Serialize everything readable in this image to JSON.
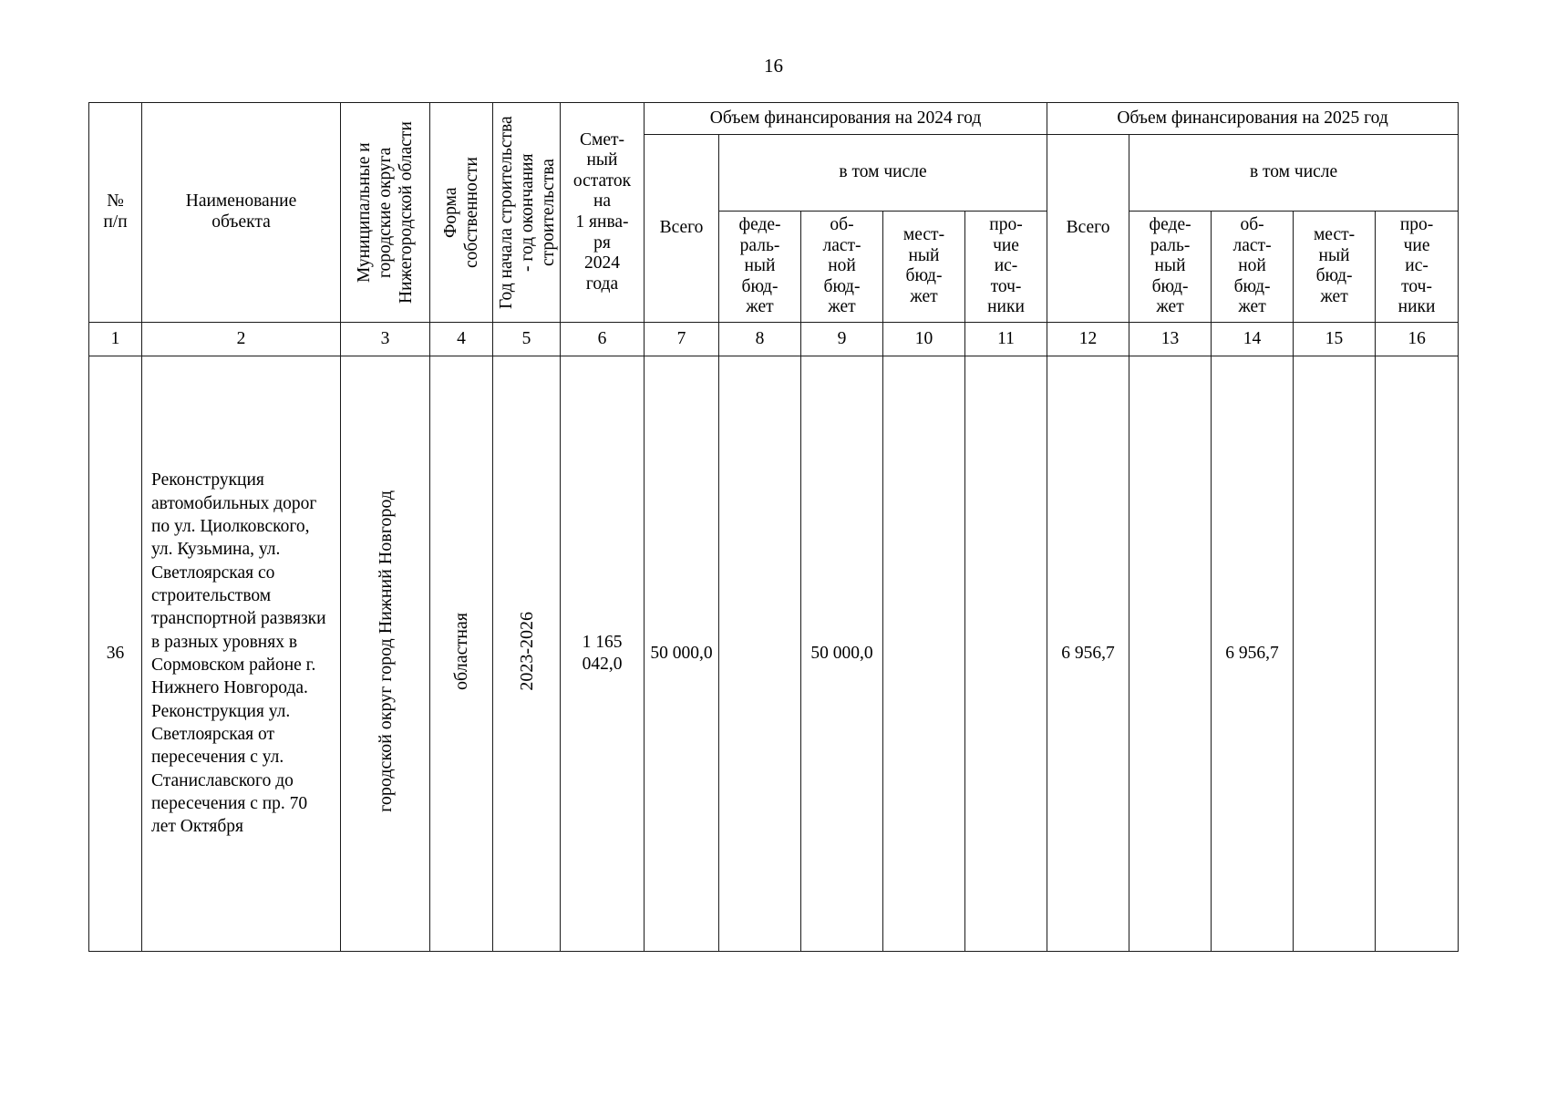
{
  "page": {
    "number": "16"
  },
  "table": {
    "headers": {
      "col_num": "№\nп/п",
      "col_num_line1": "№",
      "col_num_line2": "п/п",
      "object_name_line1": "Наименование",
      "object_name_line2": "объекта",
      "municipal": "Муниципальные и городские округа Нижегородской области",
      "ownership_form": "Форма собственности",
      "construction_years": "Год начала строительства - год окончания строительства",
      "estimate_remainder": "Сметный остаток на 1 января 2024 года",
      "estimate_remainder_lines": [
        "Смет-",
        "ный",
        "остаток",
        "на",
        "1 янва-",
        "ря",
        "2024",
        "года"
      ],
      "group_2024": "Объем финансирования на 2024 год",
      "group_2025": "Объем финансирования на 2025 год",
      "including": "в том числе",
      "total": "Всего",
      "federal_lines": [
        "феде-",
        "раль-",
        "ный",
        "бюд-",
        "жет"
      ],
      "regional_lines": [
        "об-",
        "ласт-",
        "ной",
        "бюд-",
        "жет"
      ],
      "local_lines": [
        "мест-",
        "ный",
        "бюд-",
        "жет"
      ],
      "other_lines": [
        "про-",
        "чие",
        "ис-",
        "точ-",
        "ники"
      ]
    },
    "column_numbers": [
      "1",
      "2",
      "3",
      "4",
      "5",
      "6",
      "7",
      "8",
      "9",
      "10",
      "11",
      "12",
      "13",
      "14",
      "15",
      "16"
    ],
    "rows": [
      {
        "num": "36",
        "object_name": "Реконструкция автомобильных дорог по ул. Циолковского, ул. Кузьмина, ул. Светлоярская со строительством транспортной развязки в разных уровнях в Сормовском районе г. Нижнего Новгорода. Реконструкция ул. Светлоярская от пересечения с ул. Станиславского до пересечения с пр. 70 лет Октября",
        "municipal": "городской округ город Нижний Новгород",
        "ownership_form": "областная",
        "construction_years": "2023-2026",
        "estimate_remainder": "1 165 042,0",
        "f2024_total": "50 000,0",
        "f2024_federal": "",
        "f2024_regional": "50 000,0",
        "f2024_local": "",
        "f2024_other": "",
        "f2025_total": "6 956,7",
        "f2025_federal": "",
        "f2025_regional": "6 956,7",
        "f2025_local": "",
        "f2025_other": ""
      }
    ]
  }
}
